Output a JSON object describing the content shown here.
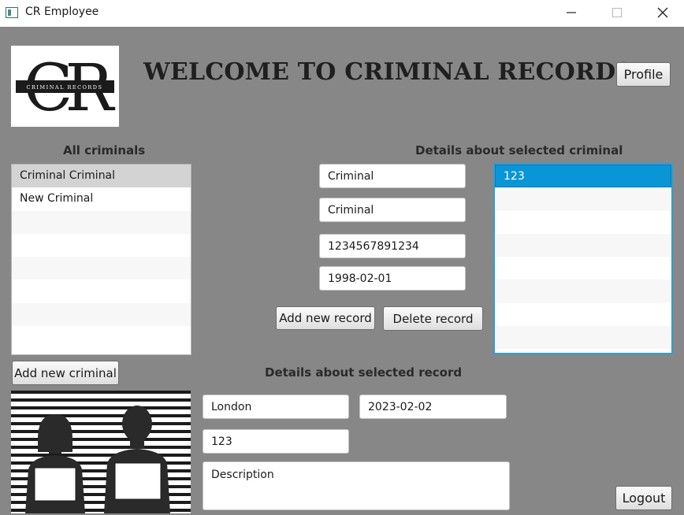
{
  "window": {
    "title": "CR Employee",
    "minimize_glyph": "—",
    "maximize_glyph": "☐",
    "close_glyph": "✕",
    "icon": "app-window-icon"
  },
  "header": {
    "logo_text": "CR",
    "logo_subtext": "CRIMINAL RECORDS",
    "title": "WELCOME TO CRIMINAL RECORDS",
    "profile_label": "Profile"
  },
  "criminals": {
    "heading": "All criminals",
    "items": [
      "Criminal Criminal",
      "New  Criminal"
    ],
    "selected_index": 0,
    "add_label": "Add new criminal"
  },
  "criminal_details": {
    "heading": "Details about selected criminal",
    "first_name": "Criminal",
    "last_name": "Criminal",
    "id_number": "1234567891234",
    "birth_date": "1998-02-01",
    "add_record_label": "Add new record",
    "delete_record_label": "Delete record",
    "records": [
      "123"
    ],
    "selected_record_index": 0
  },
  "record_details": {
    "heading": "Details about selected record",
    "city": "London",
    "date": "2023-02-02",
    "code": "123",
    "description": "Description"
  },
  "footer": {
    "logout_label": "Logout"
  }
}
